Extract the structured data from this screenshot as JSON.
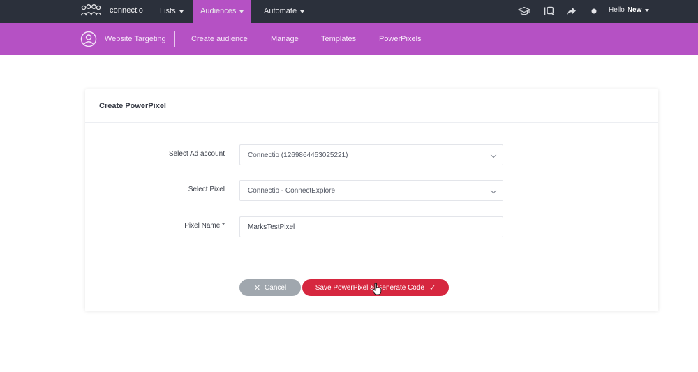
{
  "topnav": {
    "brand": "connectio",
    "lists": "Lists",
    "audiences": "Audiences",
    "automate": "Automate",
    "icons": [
      "graduation-cap-icon",
      "iq-icon",
      "share-icon",
      "status-dot-icon"
    ],
    "hello": "Hello",
    "user_name": "New"
  },
  "subnav": {
    "title": "Website Targeting",
    "links": [
      "Create audience",
      "Manage",
      "Templates",
      "PowerPixels"
    ]
  },
  "card": {
    "title": "Create PowerPixel",
    "fields": {
      "ad_account": {
        "label": "Select Ad account",
        "value": "Connectio (1269864453025221)"
      },
      "pixel": {
        "label": "Select Pixel",
        "value": "Connectio - ConnectExplore"
      },
      "pixel_name": {
        "label": "Pixel Name *",
        "value": "MarksTestPixel"
      }
    },
    "cancel_label": "Cancel",
    "save_label": "Save PowerPixel & Generate Code"
  },
  "colors": {
    "topnav_bg": "#2b303b",
    "accent_purple": "#b551c4",
    "save_red": "#d6273f",
    "cancel_gray": "#a0a7ae"
  }
}
